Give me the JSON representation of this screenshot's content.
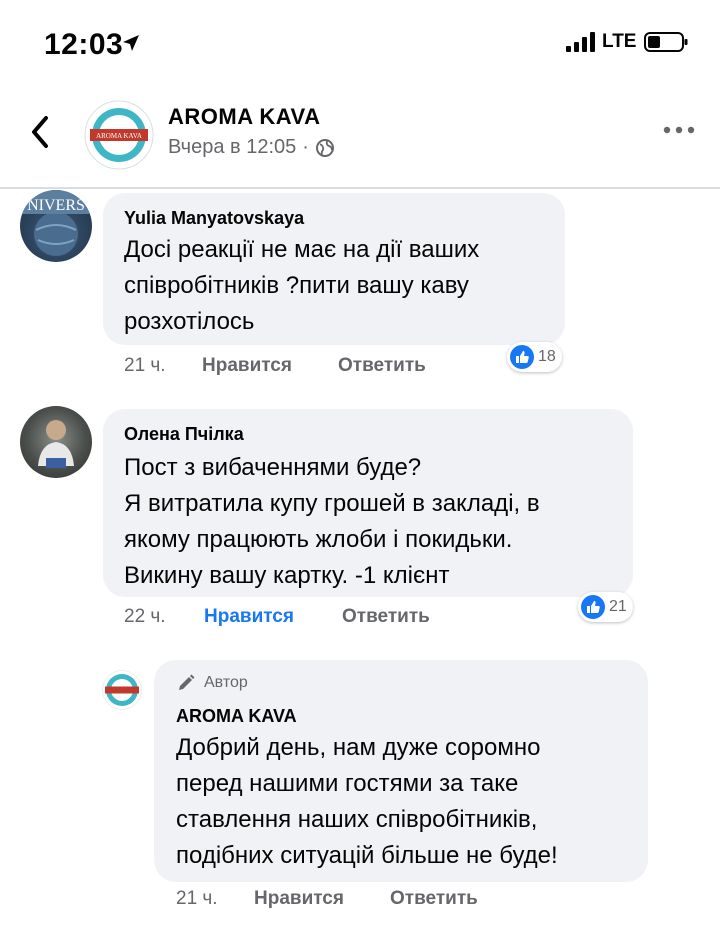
{
  "status_bar": {
    "time": "12:03",
    "carrier": "LTE"
  },
  "post": {
    "page_name": "AROMA KAVA",
    "posted_time": "Вчера в 12:05",
    "separator": "·",
    "avatar_text": "AROMA KAVA"
  },
  "comments": [
    {
      "author": "Yulia Manyatovskaya",
      "avatar_text": "NIVERS",
      "lines": [
        "Досі реакції не має на дії ваших",
        "співробітників ?пити вашу каву",
        "розхотілось"
      ],
      "time": "21 ч.",
      "like_label": "Нравится",
      "reply_label": "Ответить",
      "reactions": "18",
      "liked": false
    },
    {
      "author": "Олена Пчілка",
      "lines": [
        "Пост з вибаченнями буде?",
        "Я витратила купу грошей в закладі, в",
        "якому працюють жлоби і покидьки.",
        "Викину вашу картку. -1 клієнт"
      ],
      "time": "22 ч.",
      "like_label": "Нравится",
      "reply_label": "Ответить",
      "reactions": "21",
      "liked": true
    }
  ],
  "reply": {
    "badge": "Автор",
    "author": "AROMA KAVA",
    "lines": [
      "Добрий день, нам дуже соромно",
      "перед нашими гостями за таке",
      "ставлення наших співробітників,",
      "подібних ситуацій більше не буде!"
    ],
    "time": "21 ч.",
    "like_label": "Нравится",
    "reply_label": "Ответить"
  },
  "colors": {
    "accent": "#1877f2",
    "bubble": "#f0f2f5",
    "secondary_text": "#65676b",
    "brand_teal": "#3fb6c6"
  }
}
